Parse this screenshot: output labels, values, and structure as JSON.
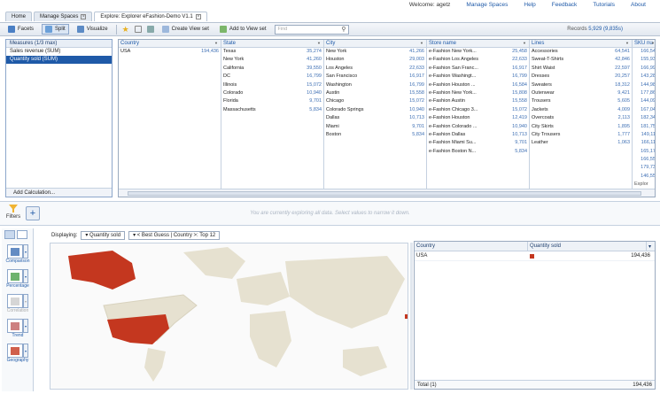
{
  "tabs": [
    {
      "label": "Home"
    },
    {
      "label": "Manage Spaces"
    },
    {
      "label": "Explore: Explorer eFashion-Demo V1.1"
    }
  ],
  "toplinks": {
    "welcome": "Welcome:",
    "user": "agetz",
    "manage": "Manage Spaces",
    "help": "Help",
    "feedback": "Feedback",
    "tutorials": "Tutorials",
    "about": "About"
  },
  "toolbar": {
    "facets": "Facets",
    "split": "Split",
    "visualize": "Visualize",
    "create_view": "Create View set",
    "add_view": "Add to View set",
    "search_placeholder": "Find",
    "records_label": "Records",
    "records_value": "5,929 (9,835s)"
  },
  "measures": {
    "header": "Measures (1/3 max)",
    "items": [
      "Sales revenue (SUM)",
      "Quantity sold (SUM)"
    ],
    "add_calc": "Add Calculation..."
  },
  "columns": [
    {
      "name": "Country",
      "rows": [
        [
          "USA",
          "194,436"
        ]
      ]
    },
    {
      "name": "State",
      "rows": [
        [
          "Texas",
          "35,274"
        ],
        [
          "New York",
          "41,260"
        ],
        [
          "California",
          "39,550"
        ],
        [
          "DC",
          "16,799"
        ],
        [
          "Illinois",
          "15,072"
        ],
        [
          "Colorado",
          "10,940"
        ],
        [
          "Florida",
          "9,701"
        ],
        [
          "Massachusetts",
          "5,834"
        ]
      ]
    },
    {
      "name": "City",
      "rows": [
        [
          "New York",
          "41,266"
        ],
        [
          "Houston",
          "29,003"
        ],
        [
          "Los Angeles",
          "22,633"
        ],
        [
          "San Francisco",
          "16,917"
        ],
        [
          "Washington",
          "16,799"
        ],
        [
          "Austin",
          "15,558"
        ],
        [
          "Chicago",
          "15,072"
        ],
        [
          "Colorado Springs",
          "10,940"
        ],
        [
          "Dallas",
          "10,713"
        ],
        [
          "Miami",
          "9,701"
        ],
        [
          "Boston",
          "5,834"
        ]
      ]
    },
    {
      "name": "Store name",
      "rows": [
        [
          "e-Fashion New York...",
          "25,458"
        ],
        [
          "e-Fashion Los Angeles",
          "22,633"
        ],
        [
          "e-Fashion San Franc...",
          "16,917"
        ],
        [
          "e-Fashion Washingt...",
          "16,799"
        ],
        [
          "e-Fashion Houston ...",
          "16,584"
        ],
        [
          "e-Fashion New York...",
          "15,808"
        ],
        [
          "e-Fashion Austin",
          "15,558"
        ],
        [
          "e-Fashion Chicago 3...",
          "15,072"
        ],
        [
          "e-Fashion Houston",
          "12,419"
        ],
        [
          "e-Fashion Colorado ...",
          "10,940"
        ],
        [
          "e-Fashion Dallas",
          "10,713"
        ],
        [
          "e-Fashion Miami Su...",
          "9,701"
        ],
        [
          "e-Fashion Boston N...",
          "5,834"
        ]
      ]
    },
    {
      "name": "Lines",
      "rows": [
        [
          "Accessories",
          "64,541"
        ],
        [
          "Sweat-T-Shirts",
          "42,846"
        ],
        [
          "Shirt Waist",
          "22,597"
        ],
        [
          "Dresses",
          "20,257"
        ],
        [
          "Sweaters",
          "18,312"
        ],
        [
          "Outerwear",
          "9,421"
        ],
        [
          "Trousers",
          "5,605"
        ],
        [
          "Jackets",
          "4,009"
        ],
        [
          "Overcoats",
          "2,113"
        ],
        [
          "City Skirts",
          "1,895"
        ],
        [
          "City Trousers",
          "1,777"
        ],
        [
          "Leather",
          "1,063"
        ]
      ]
    },
    {
      "name": "SKU nu",
      "rows": [
        [
          "",
          "166,54"
        ],
        [
          "",
          "155,93"
        ],
        [
          "",
          "166,99"
        ],
        [
          "",
          "143,28"
        ],
        [
          "",
          "144,98"
        ],
        [
          "",
          "177,86"
        ],
        [
          "",
          "144,09"
        ],
        [
          "",
          "167,04"
        ],
        [
          "",
          "182,34"
        ],
        [
          "",
          "181,75"
        ],
        [
          "",
          "149,11"
        ],
        [
          "",
          "166,11"
        ],
        [
          "",
          "165,17"
        ],
        [
          "",
          "166,55"
        ],
        [
          "",
          "179,73"
        ],
        [
          "",
          "146,55"
        ]
      ]
    }
  ],
  "sku_footer": "Explor",
  "filters": {
    "label": "Filters",
    "message": "You are currently exploring all data. Select values to narrow it down."
  },
  "displaying": {
    "label": "Displaying:",
    "measure": "Quantity sold",
    "dimension": "< Best Guess | Country >: Top 12"
  },
  "charts": [
    {
      "label": "Comparison"
    },
    {
      "label": "Percentage"
    },
    {
      "label": "Correlation"
    },
    {
      "label": "Trend"
    },
    {
      "label": "Geography"
    }
  ],
  "result": {
    "headers": [
      "Country",
      "Quantity sold"
    ],
    "rows": [
      [
        "USA",
        "194,436"
      ]
    ],
    "total_label": "Total (1)",
    "total_value": "194,436"
  },
  "colors": {
    "accent": "#1f5aa8",
    "highlight": "#c4371f",
    "land": "#e8e4d4"
  }
}
